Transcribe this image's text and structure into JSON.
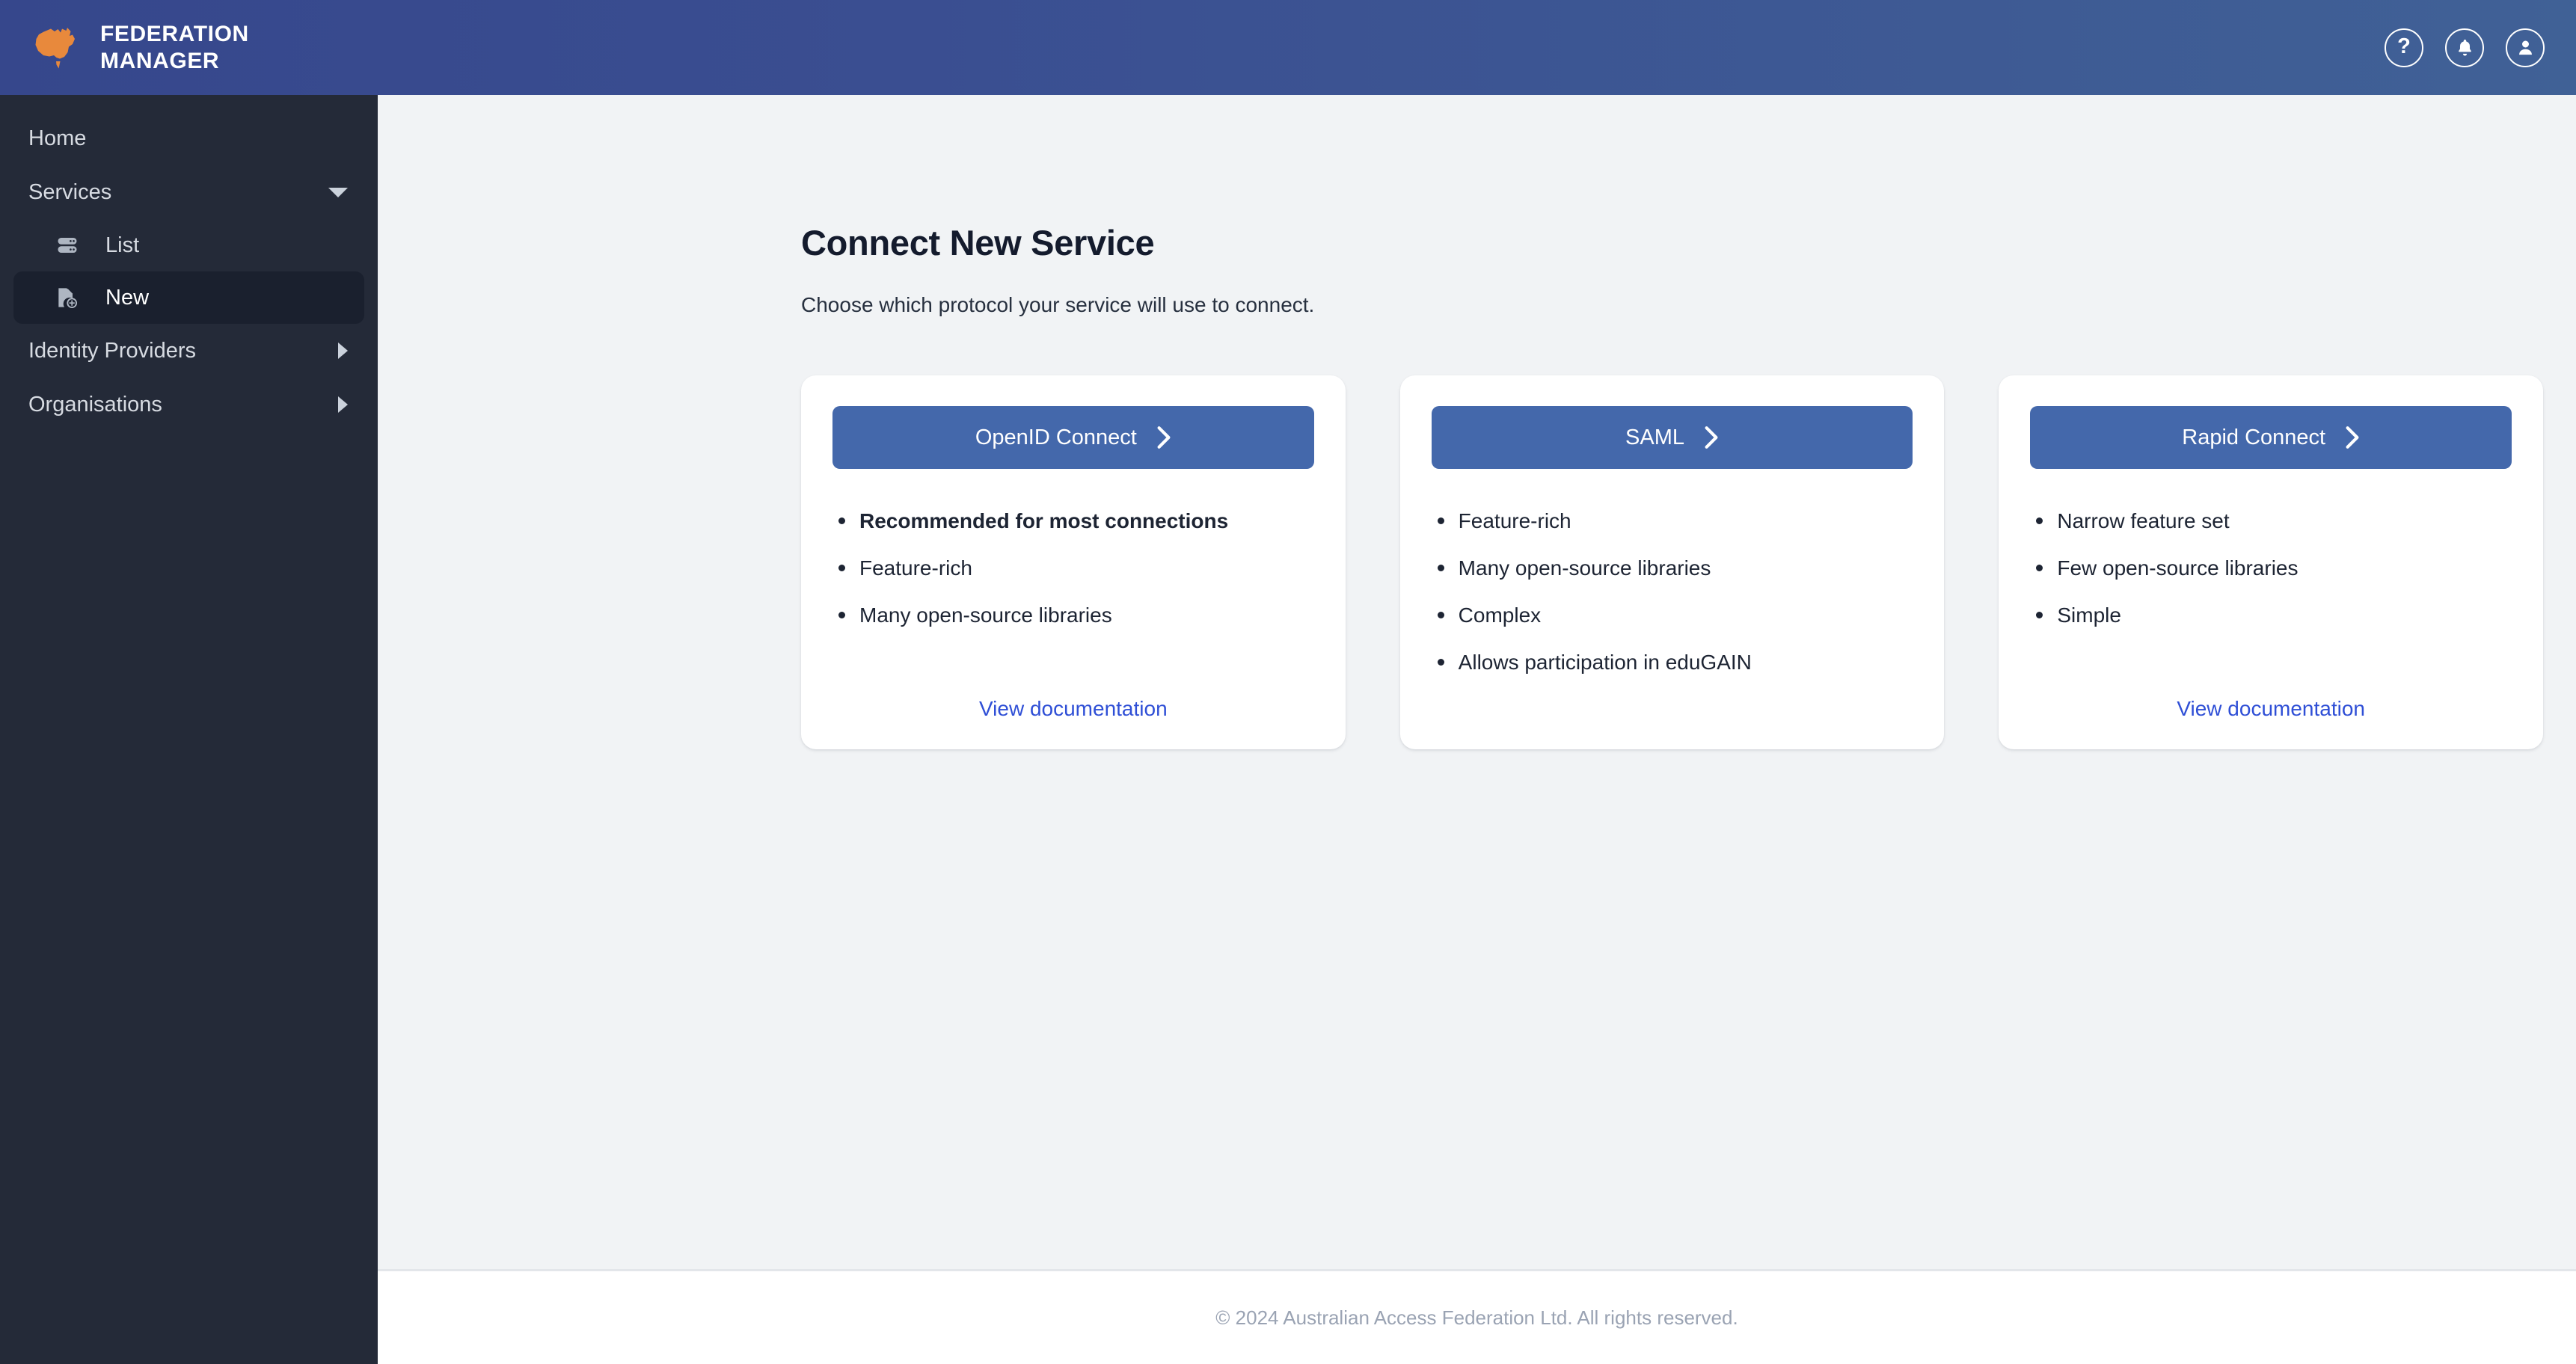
{
  "header": {
    "brand_line1": "FEDERATION",
    "brand_line2": "MANAGER",
    "logo_icon": "australia-map-icon",
    "actions": [
      {
        "name": "help-icon",
        "label": "?"
      },
      {
        "name": "notifications-bell-icon",
        "label": ""
      },
      {
        "name": "user-account-icon",
        "label": ""
      }
    ],
    "colors": {
      "gradient_start": "#36478c",
      "gradient_end": "#406196",
      "logo": "#e8893c"
    }
  },
  "sidebar": {
    "background": "#242a38",
    "active_background": "#1a202e",
    "items": [
      {
        "label": "Home",
        "icon": "",
        "expander": "none",
        "level": "top",
        "active": false
      },
      {
        "label": "Services",
        "icon": "",
        "expander": "chevron-down-icon",
        "level": "top",
        "active": false
      },
      {
        "label": "List",
        "icon": "server-icon",
        "expander": "none",
        "level": "sub",
        "active": false
      },
      {
        "label": "New",
        "icon": "file-plus-icon",
        "expander": "none",
        "level": "sub",
        "active": true
      },
      {
        "label": "Identity Providers",
        "icon": "",
        "expander": "chevron-right-icon",
        "level": "top",
        "active": false
      },
      {
        "label": "Organisations",
        "icon": "",
        "expander": "chevron-right-icon",
        "level": "top",
        "active": false
      }
    ]
  },
  "main": {
    "title": "Connect New Service",
    "subtitle": "Choose which protocol your service will use to connect.",
    "background": "#f1f3f5",
    "button_color": "#4468ab",
    "link_color": "#2f4fd6",
    "cards": [
      {
        "button_label": "OpenID Connect",
        "button_icon": "chevron-right-icon",
        "bullets": [
          {
            "text": "Recommended for most connections",
            "bold": true
          },
          {
            "text": "Feature-rich",
            "bold": false
          },
          {
            "text": "Many open-source libraries",
            "bold": false
          }
        ],
        "doc_link": "View documentation",
        "has_doc_link": true
      },
      {
        "button_label": "SAML",
        "button_icon": "chevron-right-icon",
        "bullets": [
          {
            "text": "Feature-rich",
            "bold": false
          },
          {
            "text": "Many open-source libraries",
            "bold": false
          },
          {
            "text": "Complex",
            "bold": false
          },
          {
            "text": "Allows participation in eduGAIN",
            "bold": false
          }
        ],
        "doc_link": "",
        "has_doc_link": false
      },
      {
        "button_label": "Rapid Connect",
        "button_icon": "chevron-right-icon",
        "bullets": [
          {
            "text": "Narrow feature set",
            "bold": false
          },
          {
            "text": "Few open-source libraries",
            "bold": false
          },
          {
            "text": "Simple",
            "bold": false
          }
        ],
        "doc_link": "View documentation",
        "has_doc_link": true
      }
    ]
  },
  "footer": {
    "copyright": "© 2024 Australian Access Federation Ltd. All rights reserved."
  }
}
